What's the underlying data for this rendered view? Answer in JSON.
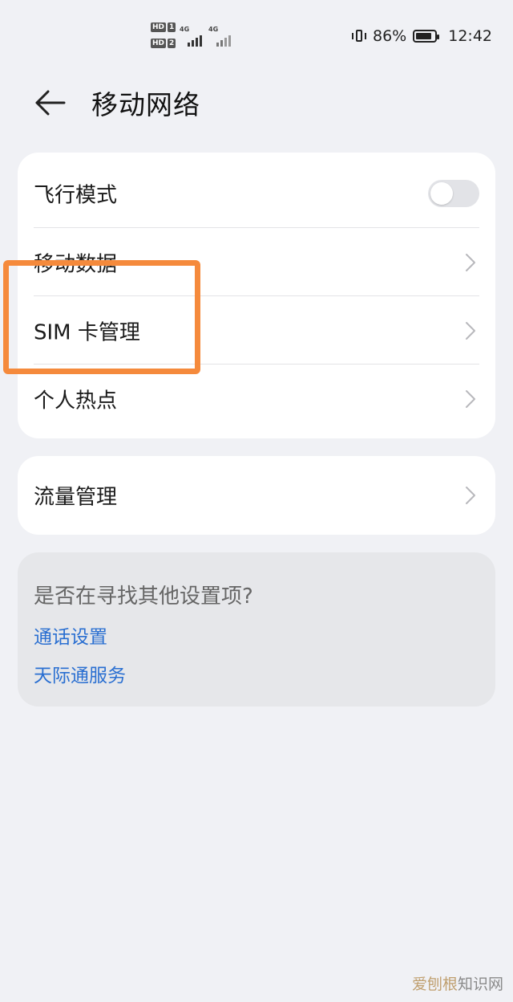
{
  "status_bar": {
    "hd1": "HD",
    "hd1_num": "1",
    "hd2": "HD",
    "hd2_num": "2",
    "net1": "4G",
    "net2": "4G",
    "battery_percent": "86%",
    "battery_level": 0.86,
    "time": "12:42"
  },
  "header": {
    "title": "移动网络",
    "back_icon": "back-arrow-icon"
  },
  "main_card": {
    "items": [
      {
        "label": "飞行模式",
        "control": "toggle",
        "on": false
      },
      {
        "label": "移动数据",
        "control": "chevron"
      },
      {
        "label": "SIM 卡管理",
        "control": "chevron"
      },
      {
        "label": "个人热点",
        "control": "chevron"
      }
    ]
  },
  "data_card": {
    "items": [
      {
        "label": "流量管理",
        "control": "chevron"
      }
    ]
  },
  "suggest": {
    "question": "是否在寻找其他设置项?",
    "links": [
      "通话设置",
      "天际通服务"
    ]
  },
  "colors": {
    "background": "#f0f1f5",
    "highlight": "#f58a3c",
    "link": "#2a6fd1"
  },
  "watermark": {
    "part1": "爱刨根",
    "part2": "知识网"
  }
}
